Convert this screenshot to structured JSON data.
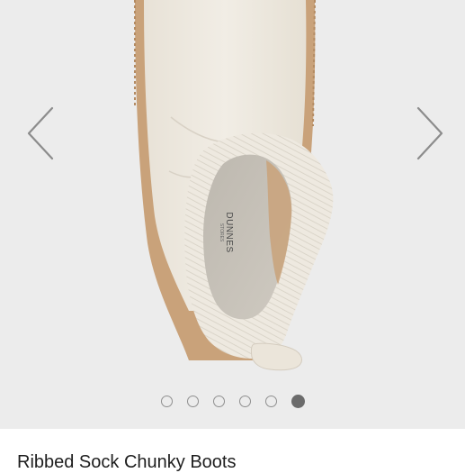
{
  "product": {
    "title": "Ribbed Sock Chunky Boots",
    "image_brand_mark": "DUNNES",
    "image_brand_sub": "STORES"
  },
  "gallery": {
    "total_images": 6,
    "active_index": 6,
    "icons": {
      "previous": "chevron-left-icon",
      "next": "chevron-right-icon"
    }
  },
  "colors": {
    "gallery_background": "#ececec",
    "boot_cream": "#efeae1",
    "sole_tan": "#c9a27a",
    "dot_inactive": "#8f8f8f",
    "dot_active": "#6b6b6b",
    "title_text": "#1e1e1e"
  }
}
